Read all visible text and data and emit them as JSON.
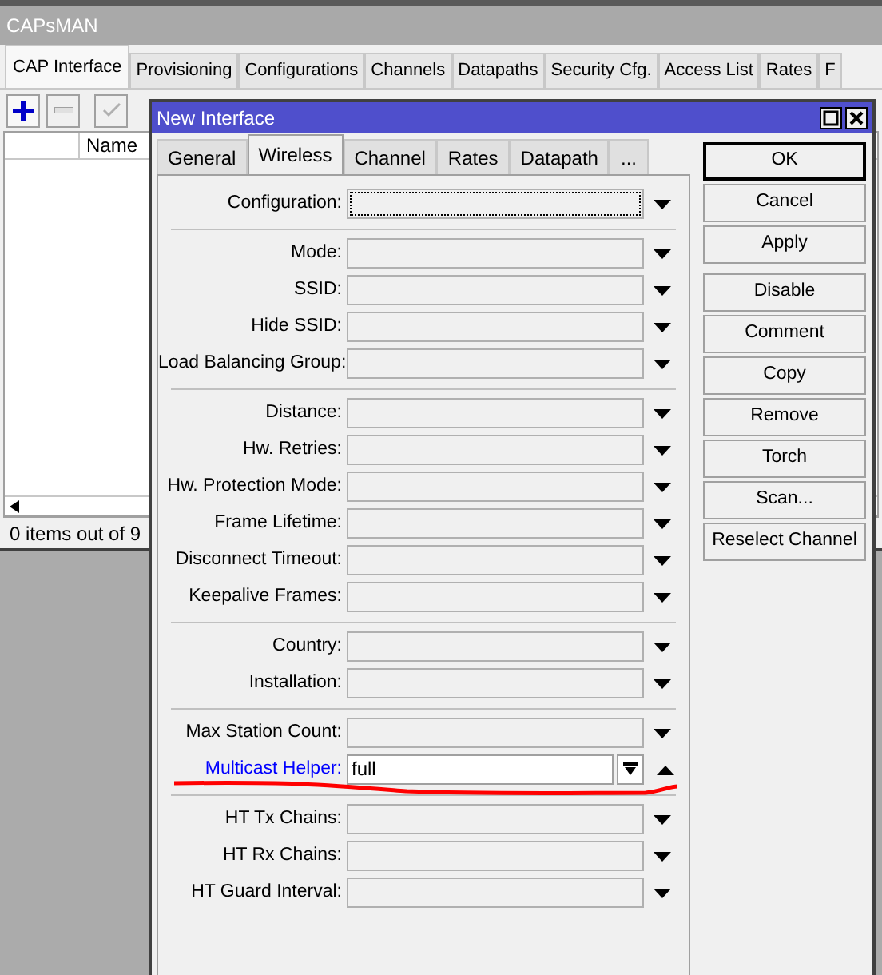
{
  "window": {
    "title": "CAPsMAN"
  },
  "tabs": [
    {
      "label": "CAP Interface",
      "selected": true
    },
    {
      "label": "Provisioning",
      "selected": false
    },
    {
      "label": "Configurations",
      "selected": false
    },
    {
      "label": "Channels",
      "selected": false
    },
    {
      "label": "Datapaths",
      "selected": false
    },
    {
      "label": "Security Cfg.",
      "selected": false
    },
    {
      "label": "Access List",
      "selected": false
    },
    {
      "label": "Rates",
      "selected": false
    },
    {
      "label": "F",
      "selected": false
    }
  ],
  "table": {
    "columns": [
      "Name"
    ]
  },
  "status_bar": "0 items out of 9",
  "dialog": {
    "title": "New Interface",
    "tabs": [
      {
        "label": "General",
        "selected": false
      },
      {
        "label": "Wireless",
        "selected": true
      },
      {
        "label": "Channel",
        "selected": false
      },
      {
        "label": "Rates",
        "selected": false
      },
      {
        "label": "Datapath",
        "selected": false
      },
      {
        "label": "...",
        "selected": false
      }
    ],
    "field_groups": [
      [
        {
          "label": "Configuration:",
          "focused": true,
          "set": false
        }
      ],
      [
        {
          "label": "Mode:",
          "focused": false,
          "set": false
        },
        {
          "label": "SSID:",
          "focused": false,
          "set": false
        },
        {
          "label": "Hide SSID:",
          "focused": false,
          "set": false
        },
        {
          "label": "Load Balancing Group:",
          "focused": false,
          "set": false
        }
      ],
      [
        {
          "label": "Distance:",
          "focused": false,
          "set": false
        },
        {
          "label": "Hw. Retries:",
          "focused": false,
          "set": false
        },
        {
          "label": "Hw. Protection Mode:",
          "focused": false,
          "set": false
        },
        {
          "label": "Frame Lifetime:",
          "focused": false,
          "set": false
        },
        {
          "label": "Disconnect Timeout:",
          "focused": false,
          "set": false
        },
        {
          "label": "Keepalive Frames:",
          "focused": false,
          "set": false
        }
      ],
      [
        {
          "label": "Country:",
          "focused": false,
          "set": false
        },
        {
          "label": "Installation:",
          "focused": false,
          "set": false
        }
      ],
      [
        {
          "label": "Max Station Count:",
          "focused": false,
          "set": false
        },
        {
          "label": "Multicast Helper:",
          "focused": false,
          "set": true,
          "value": "full"
        }
      ],
      [
        {
          "label": "HT Tx Chains:",
          "focused": false,
          "set": false
        },
        {
          "label": "HT Rx Chains:",
          "focused": false,
          "set": false
        },
        {
          "label": "HT Guard Interval:",
          "focused": false,
          "set": false
        }
      ]
    ],
    "button_groups": [
      [
        {
          "label": "OK",
          "default": true
        },
        {
          "label": "Cancel",
          "default": false
        },
        {
          "label": "Apply",
          "default": false
        }
      ],
      [
        {
          "label": "Disable",
          "default": false
        },
        {
          "label": "Comment",
          "default": false
        },
        {
          "label": "Copy",
          "default": false
        },
        {
          "label": "Remove",
          "default": false
        },
        {
          "label": "Torch",
          "default": false
        },
        {
          "label": "Scan...",
          "default": false
        },
        {
          "label": "Reselect Channel",
          "default": false
        }
      ]
    ]
  }
}
